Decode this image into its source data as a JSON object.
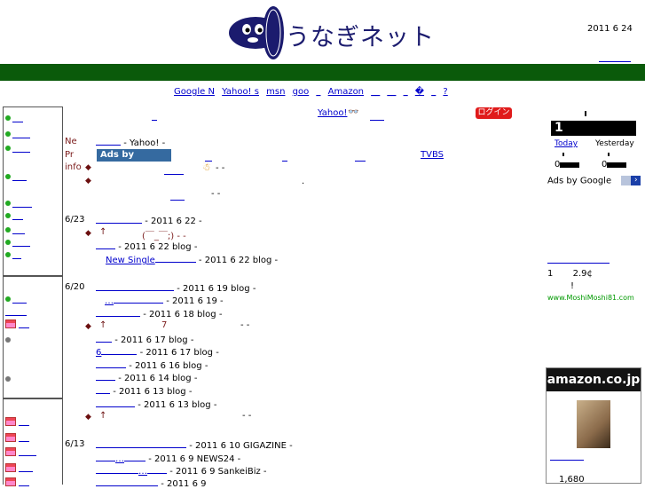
{
  "header": {
    "logo_text": "うなぎネット",
    "date": "2011 6 24"
  },
  "search_links": [
    "Google N",
    "Yahoo! s",
    "msn",
    "goo",
    "_",
    "Amazon",
    "__",
    "__",
    "_",
    "�",
    "_",
    "?"
  ],
  "top_bar": {
    "yahoo_label": "Yahoo!",
    "login": "ログイン"
  },
  "main": {
    "labels": [
      "Ne",
      "Pr",
      "info"
    ],
    "ads_label": "Ads by Google",
    "tvbs": "TVBS",
    "rows": [
      {
        "date": "",
        "text": "- Yahoo!    -"
      },
      {
        "date": "6/23",
        "text": "- 2011 6 22     -"
      },
      {
        "date": "",
        "text": "(￣_￣;)  -      -"
      },
      {
        "date": "",
        "text": "- 2011 6 22          blog -"
      },
      {
        "date": "",
        "text": "New Single",
        "tail": "- 2011 6 22         blog -"
      },
      {
        "date": "6/20",
        "text": "- 2011 6 19                    blog -"
      },
      {
        "date": "",
        "text": "…",
        "tail": "- 2011 6 19      -"
      },
      {
        "date": "",
        "text": "- 2011 6 18                  blog -"
      },
      {
        "date": "",
        "text": "7",
        "tail": "-       -"
      },
      {
        "date": "",
        "text": "- 2011 6 17          blog -"
      },
      {
        "date": "",
        "text": "6",
        "tail": "- 2011 6 17         blog -"
      },
      {
        "date": "",
        "text": "- 2011 6 16           blog -"
      },
      {
        "date": "",
        "text": "- 2011 6 14           blog -"
      },
      {
        "date": "",
        "text": "- 2011 6 13           blog -"
      },
      {
        "date": "",
        "text": "- 2011 6 13            blog -"
      },
      {
        "date": "",
        "text": "-       -"
      },
      {
        "date": "6/13",
        "text": "- 2011 6 10  GIGAZINE -"
      },
      {
        "date": "",
        "text": "…",
        "tail": "- 2011 6 9     NEWS24 -"
      },
      {
        "date": "",
        "text": "…",
        "tail": "- 2011 6 9  SankeiBiz -"
      },
      {
        "date": "",
        "text": "- 2011 6 9"
      }
    ]
  },
  "right": {
    "counter_digit": "1",
    "today": "Today",
    "yesterday": "Yesterday",
    "zero_a": "0",
    "zero_b": "0",
    "ads_by_google": "Ads by Google",
    "price_line": "1       2.9¢",
    "exclaim": "!",
    "moshi_url": "www.MoshiMoshi81.com",
    "amazon_logo": "amazon.co.jp",
    "amazon_price": "1,680"
  },
  "colors": {
    "green_bar": "#0a5a0a",
    "link": "#0000cc",
    "login_red": "#e01b1b",
    "ads_blue": "#356aa0"
  }
}
